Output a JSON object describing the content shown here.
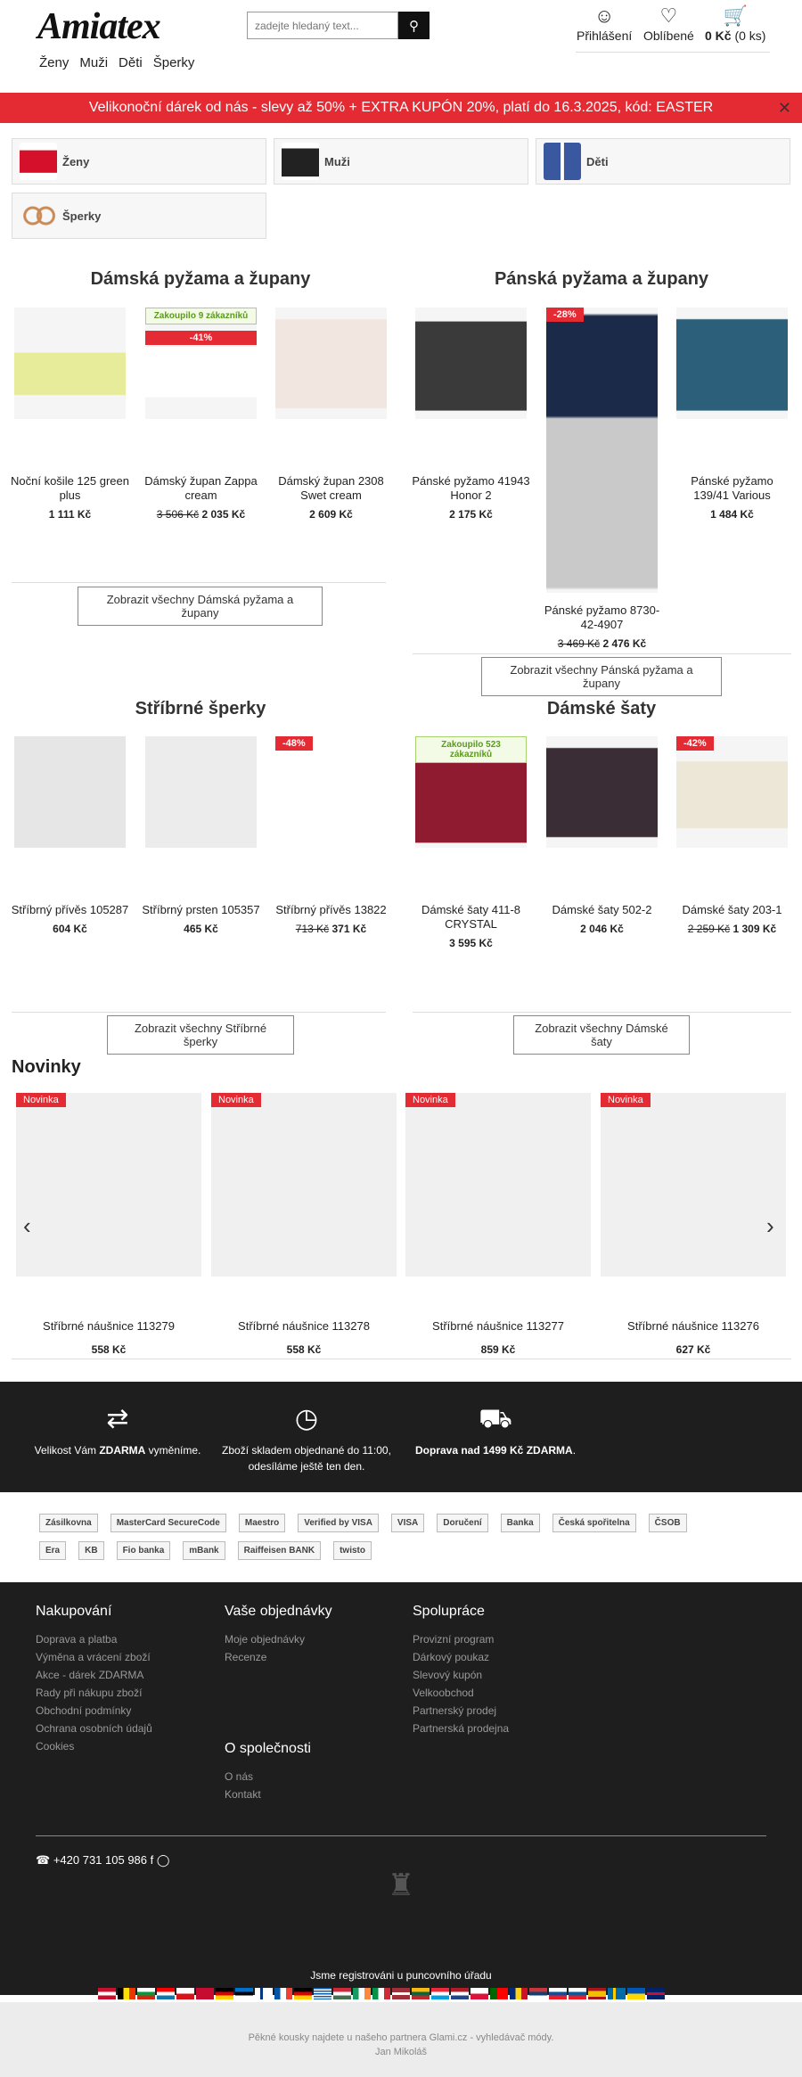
{
  "header": {
    "logo": "Amiatex",
    "search_placeholder": "zadejte hledaný text...",
    "login": "Přihlášení",
    "favorites": "Oblíbené",
    "cart_price": "0 Kč",
    "cart_count": "(0 ks)"
  },
  "topnav": [
    "Ženy",
    "Muži",
    "Děti",
    "Šperky"
  ],
  "promo": "Velikonoční dárek od nás - slevy až 50% + EXTRA KUPÓN 20%, platí do 16.3.2025, kód: EASTER",
  "categories": [
    {
      "label": "Ženy"
    },
    {
      "label": "Muži"
    },
    {
      "label": "Děti"
    },
    {
      "label": "Šperky"
    }
  ],
  "sections": {
    "women_pyjamas": {
      "title": "Dámská pyžama a župany",
      "button": "Zobrazit všechny Dámská pyžama a župany",
      "products": [
        {
          "name": "Noční košile 125 green plus",
          "price": "1 111 Kč"
        },
        {
          "name": "Dámský župan Zappa cream",
          "old_price": "3 506 Kč",
          "price": "2 035 Kč",
          "badge": "-41%",
          "bought": "Zakoupilo 9 zákazníků"
        },
        {
          "name": "Dámský župan 2308 Swet cream",
          "price": "2 609 Kč"
        }
      ]
    },
    "men_pyjamas": {
      "title": "Pánská pyžama a župany",
      "button": "Zobrazit všechny Pánská pyžama a župany",
      "products": [
        {
          "name": "Pánské pyžamo 41943 Honor 2",
          "price": "2 175 Kč"
        },
        {
          "name": "Pánské pyžamo 8730-42-4907",
          "old_price": "3 469 Kč",
          "price": "2 476 Kč",
          "badge": "-28%"
        },
        {
          "name": "Pánské pyžamo 139/41 Various",
          "price": "1 484 Kč"
        }
      ]
    },
    "silver": {
      "title": "Stříbrné šperky",
      "button": "Zobrazit všechny Stříbrné šperky",
      "products": [
        {
          "name": "Stříbrný přívěs 105287",
          "price": "604 Kč"
        },
        {
          "name": "Stříbrný prsten 105357",
          "price": "465 Kč"
        },
        {
          "name": "Stříbrný přívěs 13822",
          "old_price": "713 Kč",
          "price": "371 Kč",
          "badge": "-48%"
        }
      ]
    },
    "dresses": {
      "title": "Dámské šaty",
      "button": "Zobrazit všechny Dámské šaty",
      "products": [
        {
          "name": "Dámské šaty 411-8 CRYSTAL",
          "price": "3 595 Kč",
          "bought": "Zakoupilo 523 zákazníků"
        },
        {
          "name": "Dámské šaty 502-2",
          "price": "2 046 Kč"
        },
        {
          "name": "Dámské šaty 203-1",
          "old_price": "2 259 Kč",
          "price": "1 309 Kč",
          "badge": "-42%"
        }
      ]
    }
  },
  "novinky": {
    "title": "Novinky",
    "badge": "Novinka",
    "items": [
      {
        "name": "Stříbrné náušnice 113279",
        "price": "558 Kč"
      },
      {
        "name": "Stříbrné náušnice 113278",
        "price": "558 Kč"
      },
      {
        "name": "Stříbrné náušnice 113277",
        "price": "859 Kč"
      },
      {
        "name": "Stříbrné náušnice 113276",
        "price": "627 Kč"
      }
    ]
  },
  "benefits": [
    {
      "pre": "Velikost Vám ",
      "bold": "ZDARMA",
      "post": " vyměníme."
    },
    {
      "pre": "Zboží skladem objednané do 11:00, odesíláme ještě ten den.",
      "bold": "",
      "post": ""
    },
    {
      "pre": "",
      "bold": "Doprava nad 1499 Kč ZDARMA",
      "post": "."
    }
  ],
  "payments": [
    "Zásilkovna",
    "MasterCard SecureCode",
    "Maestro",
    "Verified by VISA",
    "VISA",
    "Doručení",
    "Banka",
    "Česká spořitelna",
    "ČSOB",
    "Era",
    "KB",
    "Fio banka",
    "mBank",
    "Raiffeisen BANK",
    "twisto"
  ],
  "footer": {
    "col1": {
      "title": "Nakupování",
      "links": [
        "Doprava a platba",
        "Výměna a vrácení zboží",
        "Akce - dárek ZDARMA",
        "Rady při nákupu zboží",
        "Obchodní podmínky",
        "Ochrana osobních údajů",
        "Cookies"
      ]
    },
    "col2": {
      "title": "Vaše objednávky",
      "links": [
        "Moje objednávky",
        "Recenze"
      ]
    },
    "col3": {
      "title": "Spolupráce",
      "links": [
        "Provizní program",
        "Dárkový poukaz",
        "Slevový kupón",
        "Velkoobchod",
        "Partnerský prodej",
        "Partnerská prodejna"
      ]
    },
    "col4": {
      "title": "O společnosti",
      "links": [
        "O nás",
        "Kontakt"
      ]
    },
    "phone": "+420 731 105 986",
    "registered": "Jsme registrováni u puncovního úřadu",
    "partner": "Pěkné kousky najdete u našeho partnera Glami.cz - vyhledávač módy.",
    "owner": "Jan Mikoláš"
  },
  "colors": {
    "accent": "#e42a33",
    "dark": "#1e1e1e",
    "green_badge": "#5a9a1d"
  }
}
